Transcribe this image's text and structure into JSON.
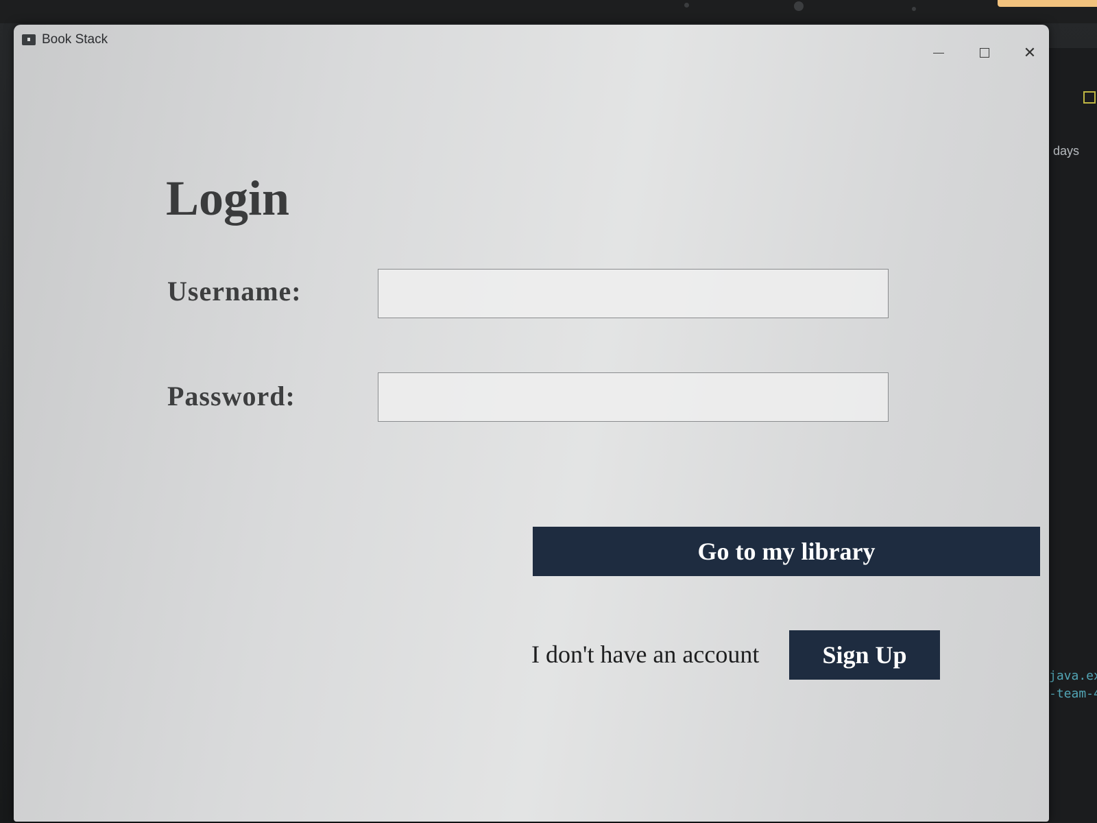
{
  "window": {
    "title": "Book Stack",
    "controls": {
      "minimize_icon": "minimize-icon",
      "maximize_icon": "maximize-icon",
      "close_icon": "close-icon",
      "close_glyph": "✕"
    }
  },
  "login": {
    "heading": "Login",
    "username_label": "Username:",
    "username_value": "",
    "password_label": "Password:",
    "password_value": "",
    "submit_label": "Go to my library",
    "no_account_text": "I don't have an account",
    "signup_label": "Sign Up"
  },
  "background_app": {
    "sidebar_text": "days",
    "code_lines": [
      "java.ex",
      "-team-4"
    ]
  },
  "colors": {
    "button_bg": "#1e2c40",
    "button_text": "#ffffff",
    "window_bg": "#dcdddd"
  }
}
